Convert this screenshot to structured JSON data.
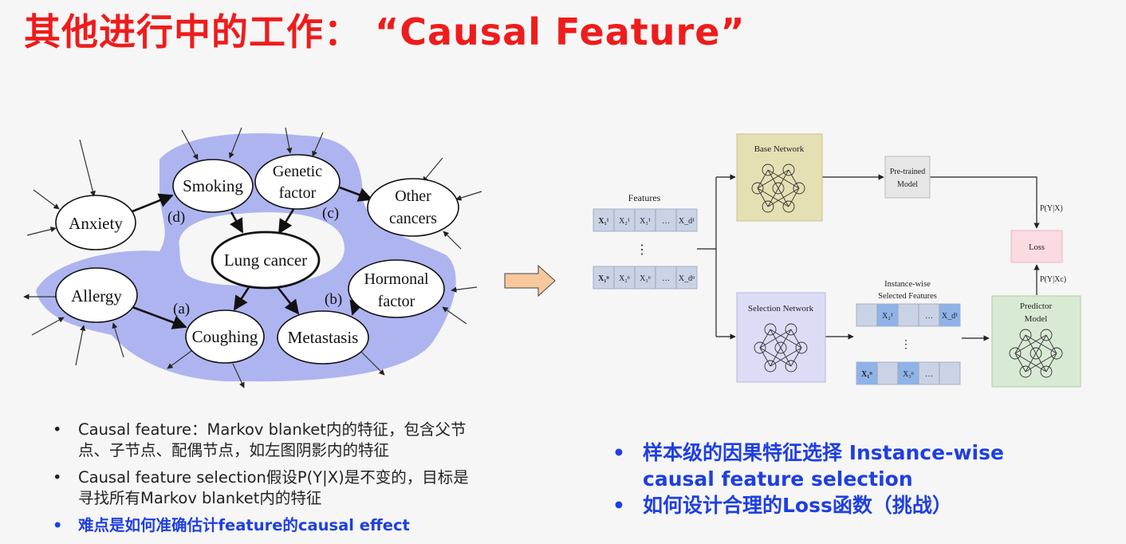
{
  "slide": {
    "title": "其他进行中的工作：  “Causal Feature”"
  },
  "causal_graph": {
    "nodes": {
      "anxiety": "Anxiety",
      "smoking": "Smoking",
      "genetic_line1": "Genetic",
      "genetic_line2": "factor",
      "other_line1": "Other",
      "other_line2": "cancers",
      "lung": "Lung cancer",
      "allergy": "Allergy",
      "hormonal_line1": "Hormonal",
      "hormonal_line2": "factor",
      "coughing": "Coughing",
      "metastasis": "Metastasis"
    },
    "edge_labels": {
      "a": "(a)",
      "b": "(b)",
      "c": "(c)",
      "d": "(d)"
    },
    "shade_color": "#aab0ef"
  },
  "pipeline": {
    "features_label": "Features",
    "feature_row_1": [
      "X₁¹",
      "X₂¹",
      "X₃¹",
      "…",
      "X_d¹"
    ],
    "feature_row_n": [
      "X₁ⁿ",
      "X₂ⁿ",
      "X₃ⁿ",
      "…",
      "X_dⁿ"
    ],
    "vertical_dots": "⋮",
    "base_network": "Base Network",
    "pretrained_line1": "Pre-trained",
    "pretrained_line2": "Model",
    "prob_full": "P(Y|X)",
    "loss": "Loss",
    "prob_causal": "P(Y|Xc)",
    "selection_network": "Selection Network",
    "instance_line1": "Instance-wise",
    "instance_line2": "Selected Features",
    "selected_row_1": [
      "",
      "X₂¹",
      "",
      "…",
      "X_d¹"
    ],
    "selected_row_n": [
      "X₁ⁿ",
      "",
      "X₃ⁿ",
      "…",
      ""
    ],
    "predictor_line1": "Predictor",
    "predictor_line2": "Model",
    "colors": {
      "base": "#e5e0b4",
      "pretrained": "#e6e6e6",
      "loss": "#f9dbe1",
      "selection": "#dcdcf6",
      "predictor": "#d9ead4",
      "feature_cell": "#c9d3e5",
      "selected_cell": "#8fb3e6",
      "arrow_fill": "#f7c89c"
    }
  },
  "left_bullets": [
    "Causal feature：Markov blanket内的特征，包含父节点、子节点、配偶节点，如左图阴影内的特征",
    "Causal feature selection假设P(Y|X)是不变的，目标是寻找所有Markov blanket内的特征",
    "难点是如何准确估计feature的causal effect"
  ],
  "right_bullets": [
    "样本级的因果特征选择 Instance-wise causal feature selection",
    "如何设计合理的Loss函数（挑战）"
  ]
}
